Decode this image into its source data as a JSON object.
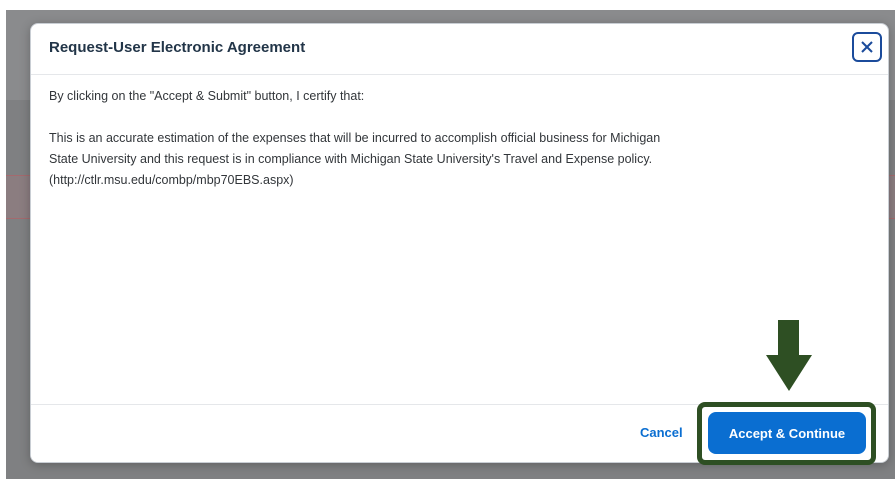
{
  "dialog": {
    "title": "Request-User Electronic Agreement",
    "close_icon": "close-icon",
    "intro": "By clicking on the \"Accept & Submit\" button, I certify that:",
    "statement_lines": [
      "This is an accurate estimation of the expenses that will be incurred to accomplish official business for Michigan",
      "State University and this request is in compliance with Michigan State University's Travel and Expense policy.",
      "(http://ctlr.msu.edu/combp/mbp70EBS.aspx)"
    ],
    "footer": {
      "cancel_label": "Cancel",
      "accept_label": "Accept & Continue"
    }
  },
  "annotation": {
    "arrow_icon": "arrow-down-icon",
    "color": "#2e4f23"
  },
  "colors": {
    "accent": "#0a6ed1",
    "title_text": "#223548",
    "body_text": "#32363a",
    "close_border": "#1b4b9b"
  }
}
